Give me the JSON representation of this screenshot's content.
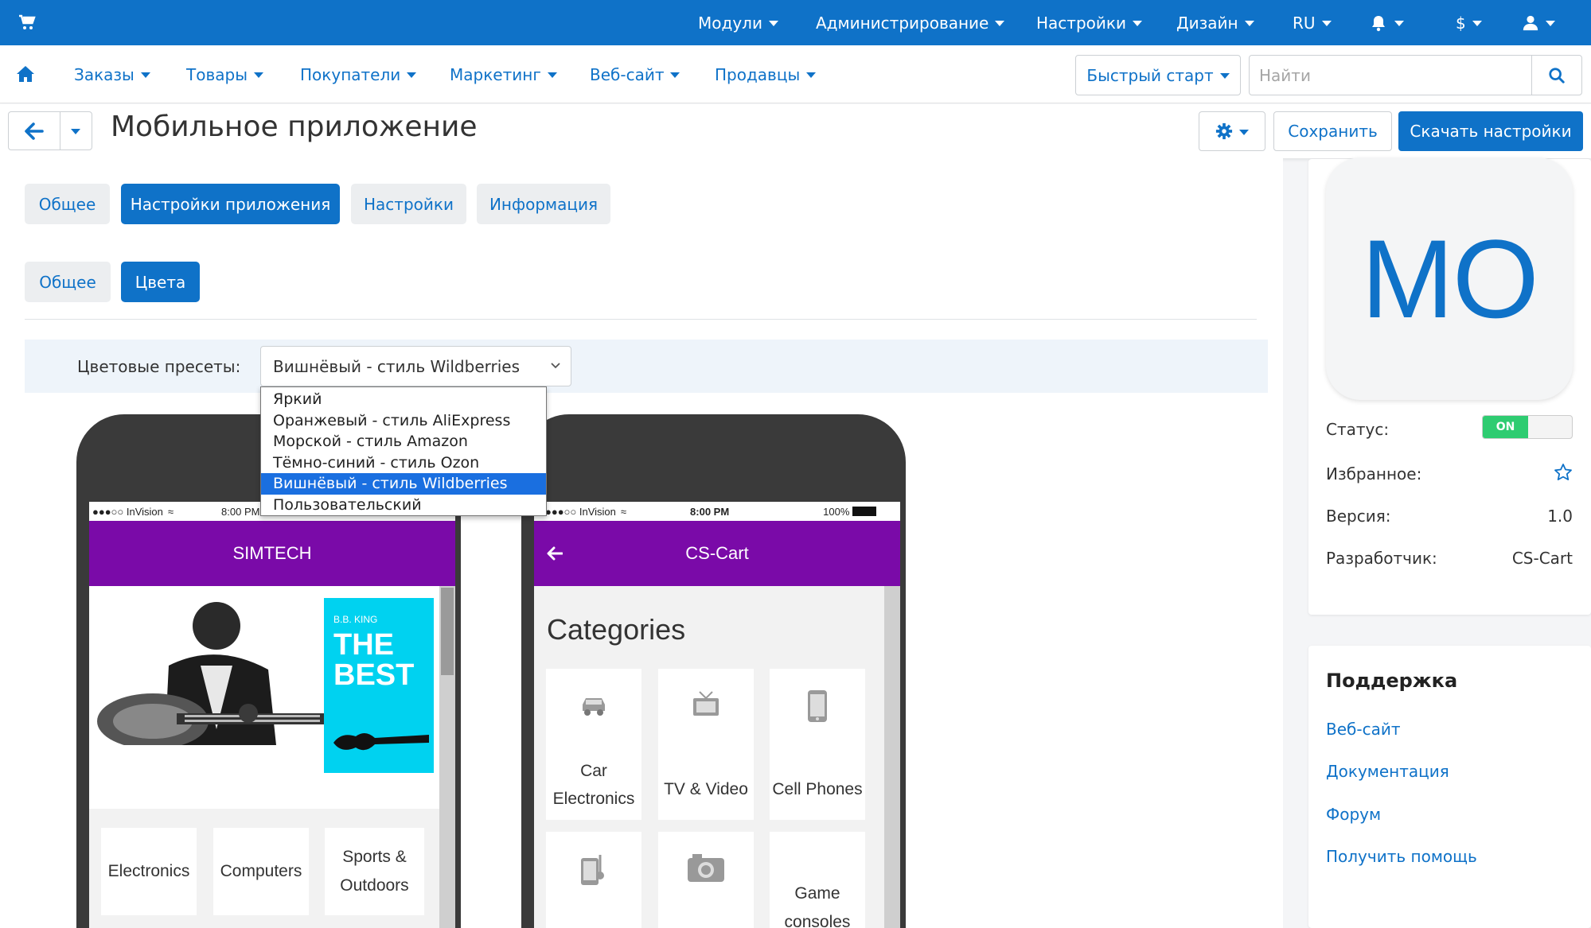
{
  "topbar": {
    "cart_icon": "cart-icon",
    "menus": [
      "Модули",
      "Администрирование",
      "Настройки",
      "Дизайн",
      "RU",
      "$"
    ],
    "bell_icon": "bell-icon",
    "user_icon": "user-icon"
  },
  "nav": {
    "home_icon": "home-icon",
    "items": [
      "Заказы",
      "Товары",
      "Покупатели",
      "Маркетинг",
      "Веб-сайт",
      "Продавцы"
    ],
    "quick_start": "Быстрый старт",
    "search_placeholder": "Найти"
  },
  "header": {
    "title": "Мобильное приложение",
    "save_label": "Сохранить",
    "download_label": "Скачать настройки"
  },
  "tabs": [
    "Общее",
    "Настройки приложения",
    "Настройки",
    "Информация"
  ],
  "subtabs": [
    "Общее",
    "Цвета"
  ],
  "presets": {
    "label": "Цветовые пресеты:",
    "selected": "Вишнёвый - стиль Wildberries",
    "options": [
      "Яркий",
      "Оранжевый - стиль AliExpress",
      "Морской - стиль Amazon",
      "Тёмно-синий - стиль Ozon",
      "Вишнёвый - стиль Wildberries",
      "Пользовательский"
    ]
  },
  "phone1": {
    "status_left": "●●●○○ InVision",
    "status_time": "8:00 PM",
    "title": "SIMTECH",
    "banner_small": "B.B. KING",
    "banner_line1": "THE",
    "banner_line2": "BEST",
    "categories": [
      "Electronics",
      "Computers",
      "Sports &",
      "Outdoors"
    ]
  },
  "phone2": {
    "status_left": "●●●○○ InVision",
    "status_time": "8:00 PM",
    "status_right": "100%",
    "title": "CS-Cart",
    "heading": "Categories",
    "categories": [
      "Car",
      "Electronics",
      "TV & Video",
      "Cell Phones",
      "Game",
      "consoles"
    ]
  },
  "sidebar": {
    "icon_text": "MO",
    "status_label": "Статус:",
    "status_value": "ON",
    "favorite_label": "Избранное:",
    "version_label": "Версия:",
    "version_value": "1.0",
    "developer_label": "Разработчик:",
    "developer_value": "CS-Cart"
  },
  "support": {
    "title": "Поддержка",
    "links": [
      "Веб-сайт",
      "Документация",
      "Форум",
      "Получить помощь"
    ]
  },
  "colors": {
    "primary": "#0f72c8",
    "app_bar": "#7a0aa8",
    "banner": "#00d2f0",
    "toggle_on": "#2ecc71"
  }
}
